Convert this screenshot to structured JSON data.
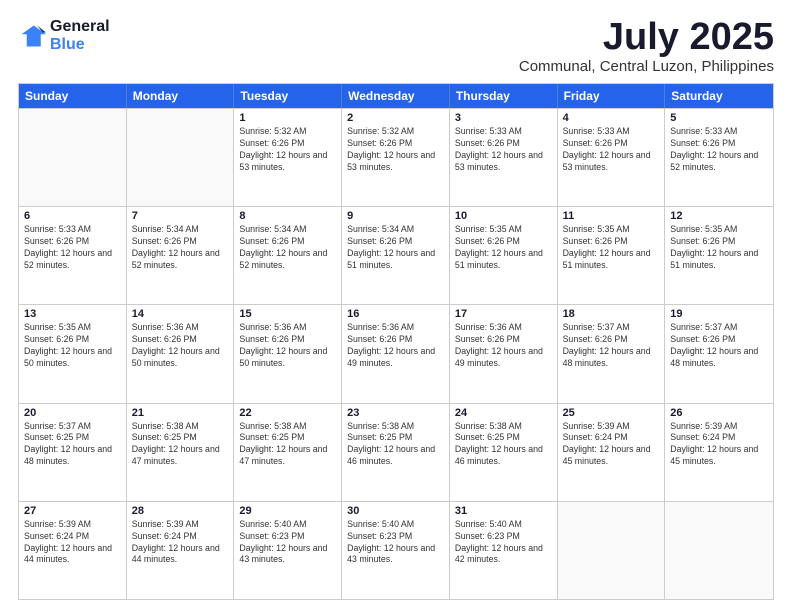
{
  "logo": {
    "general": "General",
    "blue": "Blue"
  },
  "header": {
    "month": "July 2025",
    "location": "Communal, Central Luzon, Philippines"
  },
  "days": [
    "Sunday",
    "Monday",
    "Tuesday",
    "Wednesday",
    "Thursday",
    "Friday",
    "Saturday"
  ],
  "weeks": [
    [
      {
        "day": "",
        "empty": true
      },
      {
        "day": "",
        "empty": true
      },
      {
        "num": "1",
        "rise": "5:32 AM",
        "set": "6:26 PM",
        "daylight": "12 hours and 53 minutes."
      },
      {
        "num": "2",
        "rise": "5:32 AM",
        "set": "6:26 PM",
        "daylight": "12 hours and 53 minutes."
      },
      {
        "num": "3",
        "rise": "5:33 AM",
        "set": "6:26 PM",
        "daylight": "12 hours and 53 minutes."
      },
      {
        "num": "4",
        "rise": "5:33 AM",
        "set": "6:26 PM",
        "daylight": "12 hours and 53 minutes."
      },
      {
        "num": "5",
        "rise": "5:33 AM",
        "set": "6:26 PM",
        "daylight": "12 hours and 52 minutes."
      }
    ],
    [
      {
        "num": "6",
        "rise": "5:33 AM",
        "set": "6:26 PM",
        "daylight": "12 hours and 52 minutes."
      },
      {
        "num": "7",
        "rise": "5:34 AM",
        "set": "6:26 PM",
        "daylight": "12 hours and 52 minutes."
      },
      {
        "num": "8",
        "rise": "5:34 AM",
        "set": "6:26 PM",
        "daylight": "12 hours and 52 minutes."
      },
      {
        "num": "9",
        "rise": "5:34 AM",
        "set": "6:26 PM",
        "daylight": "12 hours and 51 minutes."
      },
      {
        "num": "10",
        "rise": "5:35 AM",
        "set": "6:26 PM",
        "daylight": "12 hours and 51 minutes."
      },
      {
        "num": "11",
        "rise": "5:35 AM",
        "set": "6:26 PM",
        "daylight": "12 hours and 51 minutes."
      },
      {
        "num": "12",
        "rise": "5:35 AM",
        "set": "6:26 PM",
        "daylight": "12 hours and 51 minutes."
      }
    ],
    [
      {
        "num": "13",
        "rise": "5:35 AM",
        "set": "6:26 PM",
        "daylight": "12 hours and 50 minutes."
      },
      {
        "num": "14",
        "rise": "5:36 AM",
        "set": "6:26 PM",
        "daylight": "12 hours and 50 minutes."
      },
      {
        "num": "15",
        "rise": "5:36 AM",
        "set": "6:26 PM",
        "daylight": "12 hours and 50 minutes."
      },
      {
        "num": "16",
        "rise": "5:36 AM",
        "set": "6:26 PM",
        "daylight": "12 hours and 49 minutes."
      },
      {
        "num": "17",
        "rise": "5:36 AM",
        "set": "6:26 PM",
        "daylight": "12 hours and 49 minutes."
      },
      {
        "num": "18",
        "rise": "5:37 AM",
        "set": "6:26 PM",
        "daylight": "12 hours and 48 minutes."
      },
      {
        "num": "19",
        "rise": "5:37 AM",
        "set": "6:26 PM",
        "daylight": "12 hours and 48 minutes."
      }
    ],
    [
      {
        "num": "20",
        "rise": "5:37 AM",
        "set": "6:25 PM",
        "daylight": "12 hours and 48 minutes."
      },
      {
        "num": "21",
        "rise": "5:38 AM",
        "set": "6:25 PM",
        "daylight": "12 hours and 47 minutes."
      },
      {
        "num": "22",
        "rise": "5:38 AM",
        "set": "6:25 PM",
        "daylight": "12 hours and 47 minutes."
      },
      {
        "num": "23",
        "rise": "5:38 AM",
        "set": "6:25 PM",
        "daylight": "12 hours and 46 minutes."
      },
      {
        "num": "24",
        "rise": "5:38 AM",
        "set": "6:25 PM",
        "daylight": "12 hours and 46 minutes."
      },
      {
        "num": "25",
        "rise": "5:39 AM",
        "set": "6:24 PM",
        "daylight": "12 hours and 45 minutes."
      },
      {
        "num": "26",
        "rise": "5:39 AM",
        "set": "6:24 PM",
        "daylight": "12 hours and 45 minutes."
      }
    ],
    [
      {
        "num": "27",
        "rise": "5:39 AM",
        "set": "6:24 PM",
        "daylight": "12 hours and 44 minutes."
      },
      {
        "num": "28",
        "rise": "5:39 AM",
        "set": "6:24 PM",
        "daylight": "12 hours and 44 minutes."
      },
      {
        "num": "29",
        "rise": "5:40 AM",
        "set": "6:23 PM",
        "daylight": "12 hours and 43 minutes."
      },
      {
        "num": "30",
        "rise": "5:40 AM",
        "set": "6:23 PM",
        "daylight": "12 hours and 43 minutes."
      },
      {
        "num": "31",
        "rise": "5:40 AM",
        "set": "6:23 PM",
        "daylight": "12 hours and 42 minutes."
      },
      {
        "day": "",
        "empty": true
      },
      {
        "day": "",
        "empty": true
      }
    ]
  ],
  "labels": {
    "sunrise": "Sunrise:",
    "sunset": "Sunset:",
    "daylight": "Daylight:"
  }
}
